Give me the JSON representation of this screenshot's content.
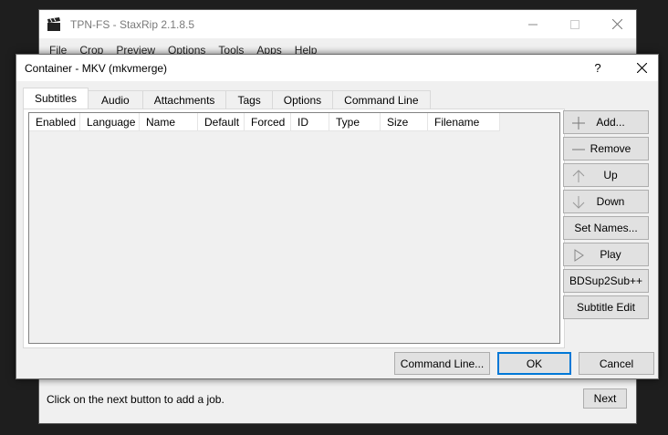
{
  "main_window": {
    "title": "TPN-FS - StaxRip 2.1.8.5",
    "menu": [
      "File",
      "Crop",
      "Preview",
      "Options",
      "Tools",
      "Apps",
      "Help"
    ],
    "status_text": "Click on the next button to add a job.",
    "next_label": "Next"
  },
  "dialog": {
    "title": "Container - MKV (mkvmerge)",
    "help_label": "?",
    "tabs": [
      "Subtitles",
      "Audio",
      "Attachments",
      "Tags",
      "Options",
      "Command Line"
    ],
    "active_tab": "Subtitles",
    "columns": [
      "Enabled",
      "Language",
      "Name",
      "Default",
      "Forced",
      "ID",
      "Type",
      "Size",
      "Filename"
    ],
    "rows": [],
    "side_buttons": {
      "add": "Add...",
      "remove": "Remove",
      "up": "Up",
      "down": "Down",
      "set_names": "Set Names...",
      "play": "Play",
      "bdsup2sub": "BDSup2Sub++",
      "subtitle_edit": "Subtitle Edit"
    },
    "bottom_buttons": {
      "command_line": "Command Line...",
      "ok": "OK",
      "cancel": "Cancel"
    }
  },
  "colors": {
    "background": "#1e1e1e",
    "window": "#f0f0f0",
    "button": "#e1e1e1",
    "focus_border": "#0078d7"
  }
}
